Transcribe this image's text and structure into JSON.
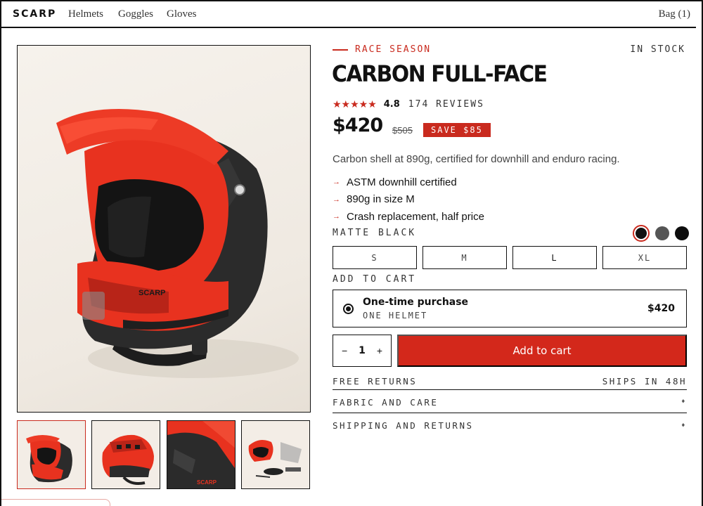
{
  "nav": {
    "logo": "SCARP",
    "links": [
      "Helmets",
      "Goggles",
      "Gloves"
    ],
    "bag": "Bag (1)"
  },
  "product": {
    "eyebrow": "RACE SEASON",
    "stock": "IN STOCK",
    "title": "CARBON FULL-FACE",
    "stars": "★★★★★",
    "rating": "4.8",
    "reviews": "174 REVIEWS",
    "price": "$420",
    "old_price": "$505",
    "save": "SAVE $85",
    "description": "Carbon shell at 890g, certified for downhill and enduro racing.",
    "features": [
      "ASTM downhill certified",
      "890g in size M",
      "Crash replacement, half price"
    ],
    "color_label": "MATTE BLACK",
    "swatch_colors": [
      "#111111",
      "#555555",
      "#0d0d0d"
    ],
    "sizes": [
      "S",
      "M",
      "L",
      "XL"
    ],
    "selected_size": "L"
  },
  "cart": {
    "label": "ADD TO CART",
    "option_title": "One-time purchase",
    "option_sub": "ONE HELMET",
    "option_price": "$420",
    "qty_minus": "−",
    "qty": "1",
    "qty_plus": "+",
    "add_button": "Add to cart"
  },
  "info": {
    "returns": "FREE RETURNS",
    "ships": "SHIPS IN 48H",
    "fabric": "FABRIC AND CARE",
    "shipping": "SHIPPING AND RETURNS",
    "expand_glyph": "♦"
  },
  "colors": {
    "accent": "#d3281b",
    "helmet_red": "#e8321f",
    "carbon": "#2b2b2b"
  }
}
